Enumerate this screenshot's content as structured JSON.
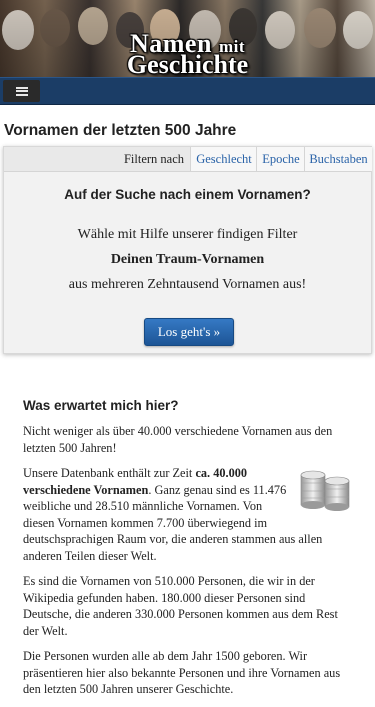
{
  "banner": {
    "title_line1": "Namen",
    "title_line1_small": "mit",
    "title_line2": "Geschichte"
  },
  "navbar": {
    "menu_icon": "hamburger-menu-icon",
    "color": "#1b3d66"
  },
  "page": {
    "title": "Vornamen der letzten 500 Jahre"
  },
  "filter": {
    "label": "Filtern nach",
    "links": [
      "Geschlecht",
      "Epoche",
      "Buchstaben"
    ],
    "heading": "Auf der Suche nach einem Vornamen?",
    "line1": "Wähle mit Hilfe unserer findigen Filter",
    "line2": "Deinen Traum-Vornamen",
    "line3": "aus mehreren Zehntausend Vornamen aus!",
    "cta": "Los geht's »"
  },
  "info": {
    "heading": "Was erwartet mich hier?",
    "p1": "Nicht weniger als über 40.000 verschiedene Vornamen aus den letzten 500 Jahren!",
    "p2_prefix": "Unsere Datenbank enthält zur Zeit ",
    "p2_bold": "ca. 40.000 verschiedene Vornamen",
    "p2_suffix": ". Ganz genau sind es 11.476 weibliche und 28.510 männliche Vornamen. Von diesen Vornamen kommen 7.700 überwiegend im deutschsprachigen Raum vor, die anderen stammen aus allen anderen Teilen dieser Welt.",
    "p3": "Es sind die Vornamen von 510.000 Personen, die wir in der Wikipedia gefunden haben. 180.000 dieser Personen sind Deutsche, die anderen 330.000 Personen kommen aus dem Rest der Welt.",
    "p4": "Die Personen wurden alle ab dem Jahr 1500 geboren. Wir präsentieren hier also bekannte Personen und ihre Vornamen aus den letzten 500 Jahren unserer Geschichte.",
    "image_icon": "coin-stacks-icon"
  }
}
